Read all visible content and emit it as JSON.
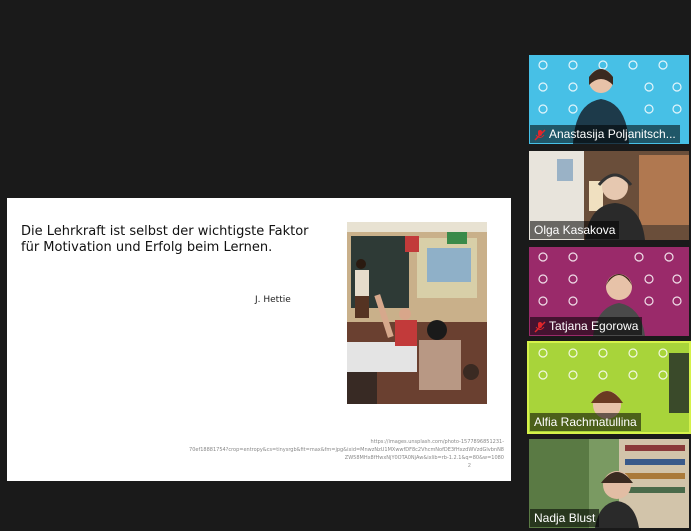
{
  "slide": {
    "quote_line1": "Die Lehrkraft ist selbst der wichtigste Faktor",
    "quote_line2": "für Motivation und Erfolg beim Lernen.",
    "author": "J. Hettie",
    "credit_line1": "https://images.unsplash.com/photo-1577896851231-",
    "credit_line2": "70ef18881754?crop=entropy&cs=tinysrgb&fit=max&fm=jpg&ixid=MnwzNzU1MXwwfDF8c2VhcmNofDE3fHxzdWVzdGlvbnN8",
    "credit_line3": "ZW58MHx8fHwxNjY0OTA0NjAw&ixlib=rb-1.2.1&q=80&w=1080",
    "page_number": "2"
  },
  "participants": [
    {
      "name": "Anastasija Poljanitsch...",
      "muted": true,
      "bg": "#47c0e6"
    },
    {
      "name": "Olga Kasakova",
      "muted": false,
      "bg": "#7a5a44"
    },
    {
      "name": "Tatjana Egorowa",
      "muted": true,
      "bg": "#9a2a6a"
    },
    {
      "name": "Alfia Rachmatullina",
      "muted": false,
      "bg": "#a8d43a",
      "active": true
    },
    {
      "name": "Nadja Blust",
      "muted": false,
      "bg": "#5a7a4a"
    }
  ],
  "colors": {
    "active_border": "#d6f24a",
    "muted_icon": "#e0262b"
  }
}
